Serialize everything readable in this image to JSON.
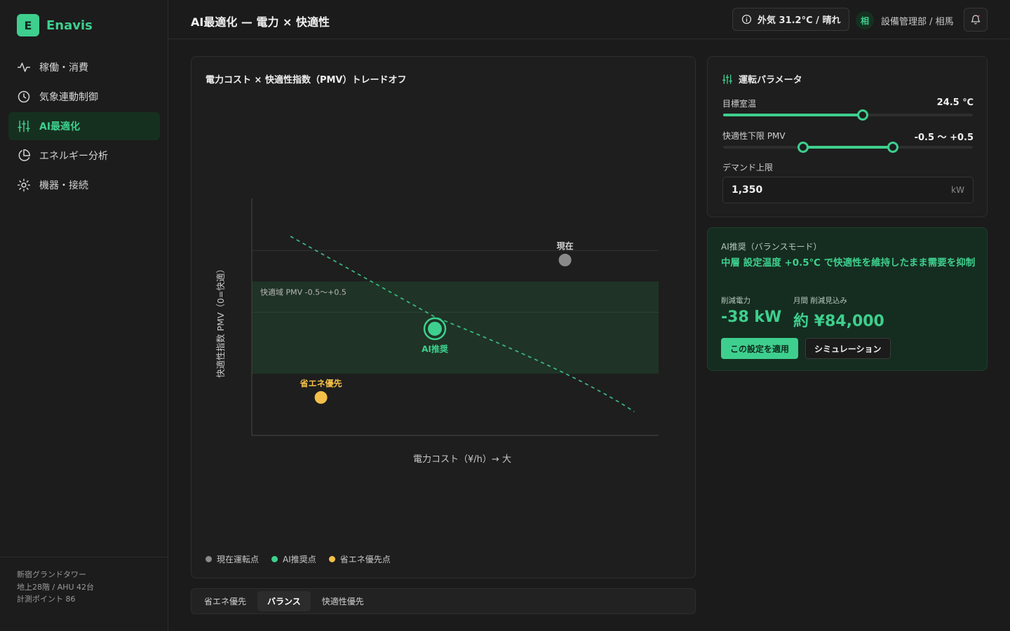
{
  "brand": {
    "logo_letter": "E",
    "name": "Enavis"
  },
  "sidebar": {
    "items": [
      {
        "label": "稼働・消費",
        "icon": "activity-icon"
      },
      {
        "label": "気象連動制御",
        "icon": "clock-icon"
      },
      {
        "label": "AI最適化",
        "icon": "sliders-icon",
        "active": true
      },
      {
        "label": "エネルギー分析",
        "icon": "pie-chart-icon"
      },
      {
        "label": "機器・接続",
        "icon": "sun-gear-icon"
      }
    ],
    "footer": {
      "building": "新宿グランドタワー",
      "floors": "地上28階 / AHU 42台",
      "points": "計測ポイント 86"
    }
  },
  "header": {
    "title": "AI最適化 — 電力 × 快適性",
    "weather": "外気 31.2°C / 晴れ",
    "user_initial": "相",
    "user": "設備管理部 / 相馬"
  },
  "chart_card": {
    "title": "電力コスト × 快適性指数（PMV）トレードオフ",
    "legend": [
      {
        "label": "現在運転点",
        "color": "#8a8a8a"
      },
      {
        "label": "AI推奨点",
        "color": "#3ecf8e"
      },
      {
        "label": "省エネ優先点",
        "color": "#f5c04a"
      }
    ]
  },
  "chart_data": {
    "type": "scatter",
    "xlabel": "電力コスト（¥/h）→ 大",
    "ylabel": "快適性指数 PMV（0=快適）",
    "band_label": "快適域 PMV -0.5〜+0.5",
    "points": [
      {
        "name": "現在",
        "x": 0.77,
        "y": 0.74,
        "color": "#8a8a8a"
      },
      {
        "name": "AI推奨",
        "x": 0.45,
        "y": 0.45,
        "color": "#3ecf8e"
      },
      {
        "name": "省エネ優先",
        "x": 0.17,
        "y": 0.16,
        "color": "#f5c04a"
      }
    ],
    "frontier": [
      [
        0.095,
        0.84
      ],
      [
        0.45,
        0.5
      ],
      [
        0.8,
        0.26
      ],
      [
        0.94,
        0.1
      ]
    ],
    "band": [
      0.26,
      0.65
    ],
    "grid_lines": [
      0.78,
      0.52
    ]
  },
  "modes": {
    "items": [
      "省エネ優先",
      "バランス",
      "快適性優先"
    ],
    "active": "バランス"
  },
  "params": {
    "title": "運転パラメータ",
    "target_temp": {
      "label": "目標室温",
      "value": "24.5 ℃",
      "fill": 0.56
    },
    "pmv": {
      "label": "快適性下限 PMV",
      "value": "-0.5 〜 +0.5",
      "low": 0.32,
      "high": 0.68
    },
    "demand": {
      "label": "デマンド上限",
      "value": "1,350",
      "unit": "kW"
    }
  },
  "recommendation": {
    "label": "AI推奨（バランスモード）",
    "headline": "中層 設定温度 +0.5℃ で快適性を維持したまま需要を抑制",
    "power_label": "削減電力",
    "power_value": "-38 kW",
    "monthly_label": "月間 削減見込み",
    "monthly_value": "約 ¥84,000",
    "apply_label": "この設定を適用",
    "simulate_label": "シミュレーション"
  }
}
